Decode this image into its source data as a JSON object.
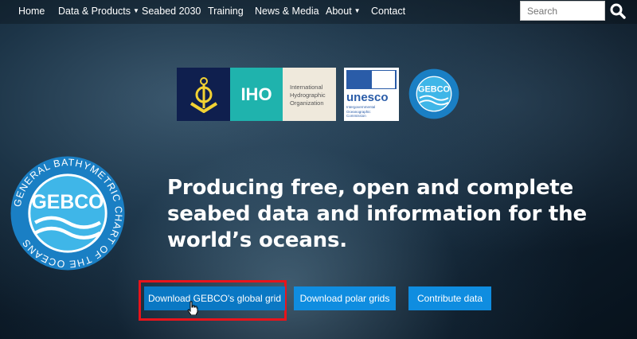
{
  "nav": {
    "items": [
      {
        "label": "Home"
      },
      {
        "label": "Data & Products",
        "dropdown": true
      },
      {
        "label": "Seabed 2030"
      },
      {
        "label": "Training"
      },
      {
        "label": "News & Media"
      },
      {
        "label": "About",
        "dropdown": true
      },
      {
        "label": "Contact"
      }
    ],
    "search_placeholder": "Search",
    "search_icon": "search-icon"
  },
  "partners": {
    "iho_abbr": "IHO",
    "iho_name": [
      "International",
      "Hydrographic",
      "Organization"
    ],
    "unesco_word": "unesco",
    "unesco_sub": [
      "Intergovernmental",
      "Oceanographic",
      "Commission"
    ],
    "gebco_logo_text": "GEBCO",
    "gebco_logo_ring": "GENERAL BATHYMETRIC CHART OF THE OCEANS"
  },
  "hero": {
    "headline": "Producing free, open and complete seabed data and information for the world’s oceans."
  },
  "buttons": [
    {
      "label": "Download GEBCO's global grid"
    },
    {
      "label": "Download polar grids"
    },
    {
      "label": "Contribute data"
    }
  ],
  "colors": {
    "button": "#0f8de0",
    "highlight": "#e8141b",
    "iho_teal": "#1fb3ad",
    "iho_navy": "#0f1f4e"
  }
}
